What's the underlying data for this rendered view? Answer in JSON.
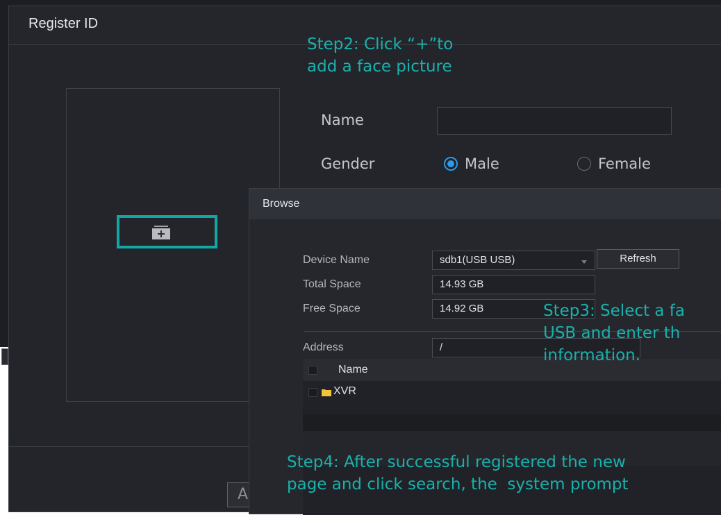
{
  "register_window": {
    "title": "Register ID",
    "name_label": "Name",
    "name_value": "",
    "gender_label": "Gender",
    "gender_options": [
      "Male",
      "Female"
    ],
    "gender_selected": "Male",
    "footer_button_label": "A"
  },
  "browse_window": {
    "title": "Browse",
    "device_name_label": "Device Name",
    "device_name_value": "sdb1(USB USB)",
    "refresh_label": "Refresh",
    "total_space_label": "Total Space",
    "total_space_value": "14.93 GB",
    "free_space_label": "Free Space",
    "free_space_value": "14.92 GB",
    "address_label": "Address",
    "address_value": "/",
    "file_list": {
      "header": "Name",
      "items": [
        {
          "name": "XVR",
          "type": "folder"
        }
      ]
    }
  },
  "annotations": {
    "step2": "Step2: Click “+”to\nadd a face picture",
    "step3": "Step3: Select a fa\nUSB and enter th\ninformation.",
    "step4": "Step4: After successful registered the new\npage and click search, the  system prompt"
  },
  "colors": {
    "annotation": "#19b1ac",
    "accent": "#2f9ae8",
    "folder": "#f3c33a"
  },
  "icons": {
    "add_face": "add-image-icon",
    "folder": "folder-icon",
    "dropdown": "chevron-down-icon"
  }
}
